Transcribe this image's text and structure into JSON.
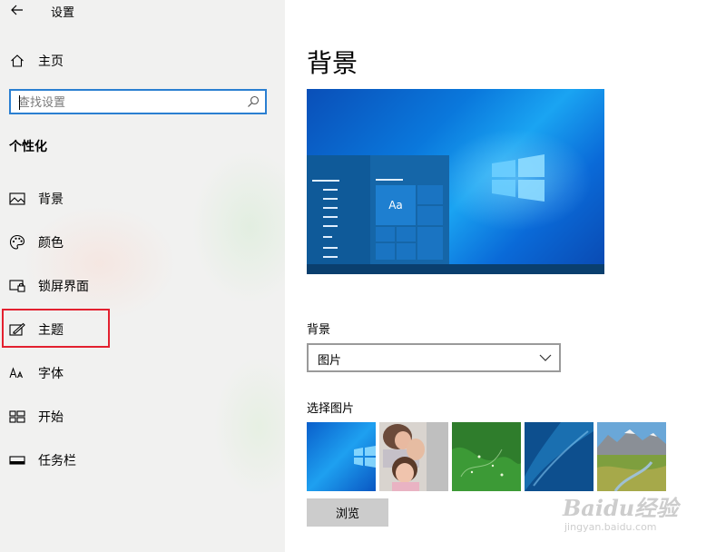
{
  "window": {
    "title": "设置"
  },
  "sidebar": {
    "home_label": "主页",
    "search_placeholder": "查找设置",
    "section_title": "个性化",
    "items": [
      {
        "label": "背景",
        "icon": "picture-icon"
      },
      {
        "label": "颜色",
        "icon": "palette-icon"
      },
      {
        "label": "锁屏界面",
        "icon": "lock-screen-icon"
      },
      {
        "label": "主题",
        "icon": "theme-brush-icon",
        "highlighted": true
      },
      {
        "label": "字体",
        "icon": "font-icon"
      },
      {
        "label": "开始",
        "icon": "start-tiles-icon"
      },
      {
        "label": "任务栏",
        "icon": "taskbar-icon"
      }
    ]
  },
  "main": {
    "title": "背景",
    "preview": {
      "tile_text": "Aa"
    },
    "background_label": "背景",
    "background_value": "图片",
    "choose_picture_label": "选择图片",
    "thumbnails": [
      "windows-blue-wallpaper",
      "child-photo",
      "green-aerial",
      "blue-ocean-aerial",
      "mountain-valley-landscape"
    ],
    "browse_label": "浏览"
  },
  "watermark": {
    "line1": "Baidu经验",
    "line2": "jingyan.baidu.com"
  },
  "colors": {
    "accent": "#2a7fd1",
    "highlight": "#e3202f",
    "sidebar_bg": "#f1f1f0",
    "button_bg": "#cccccc"
  }
}
